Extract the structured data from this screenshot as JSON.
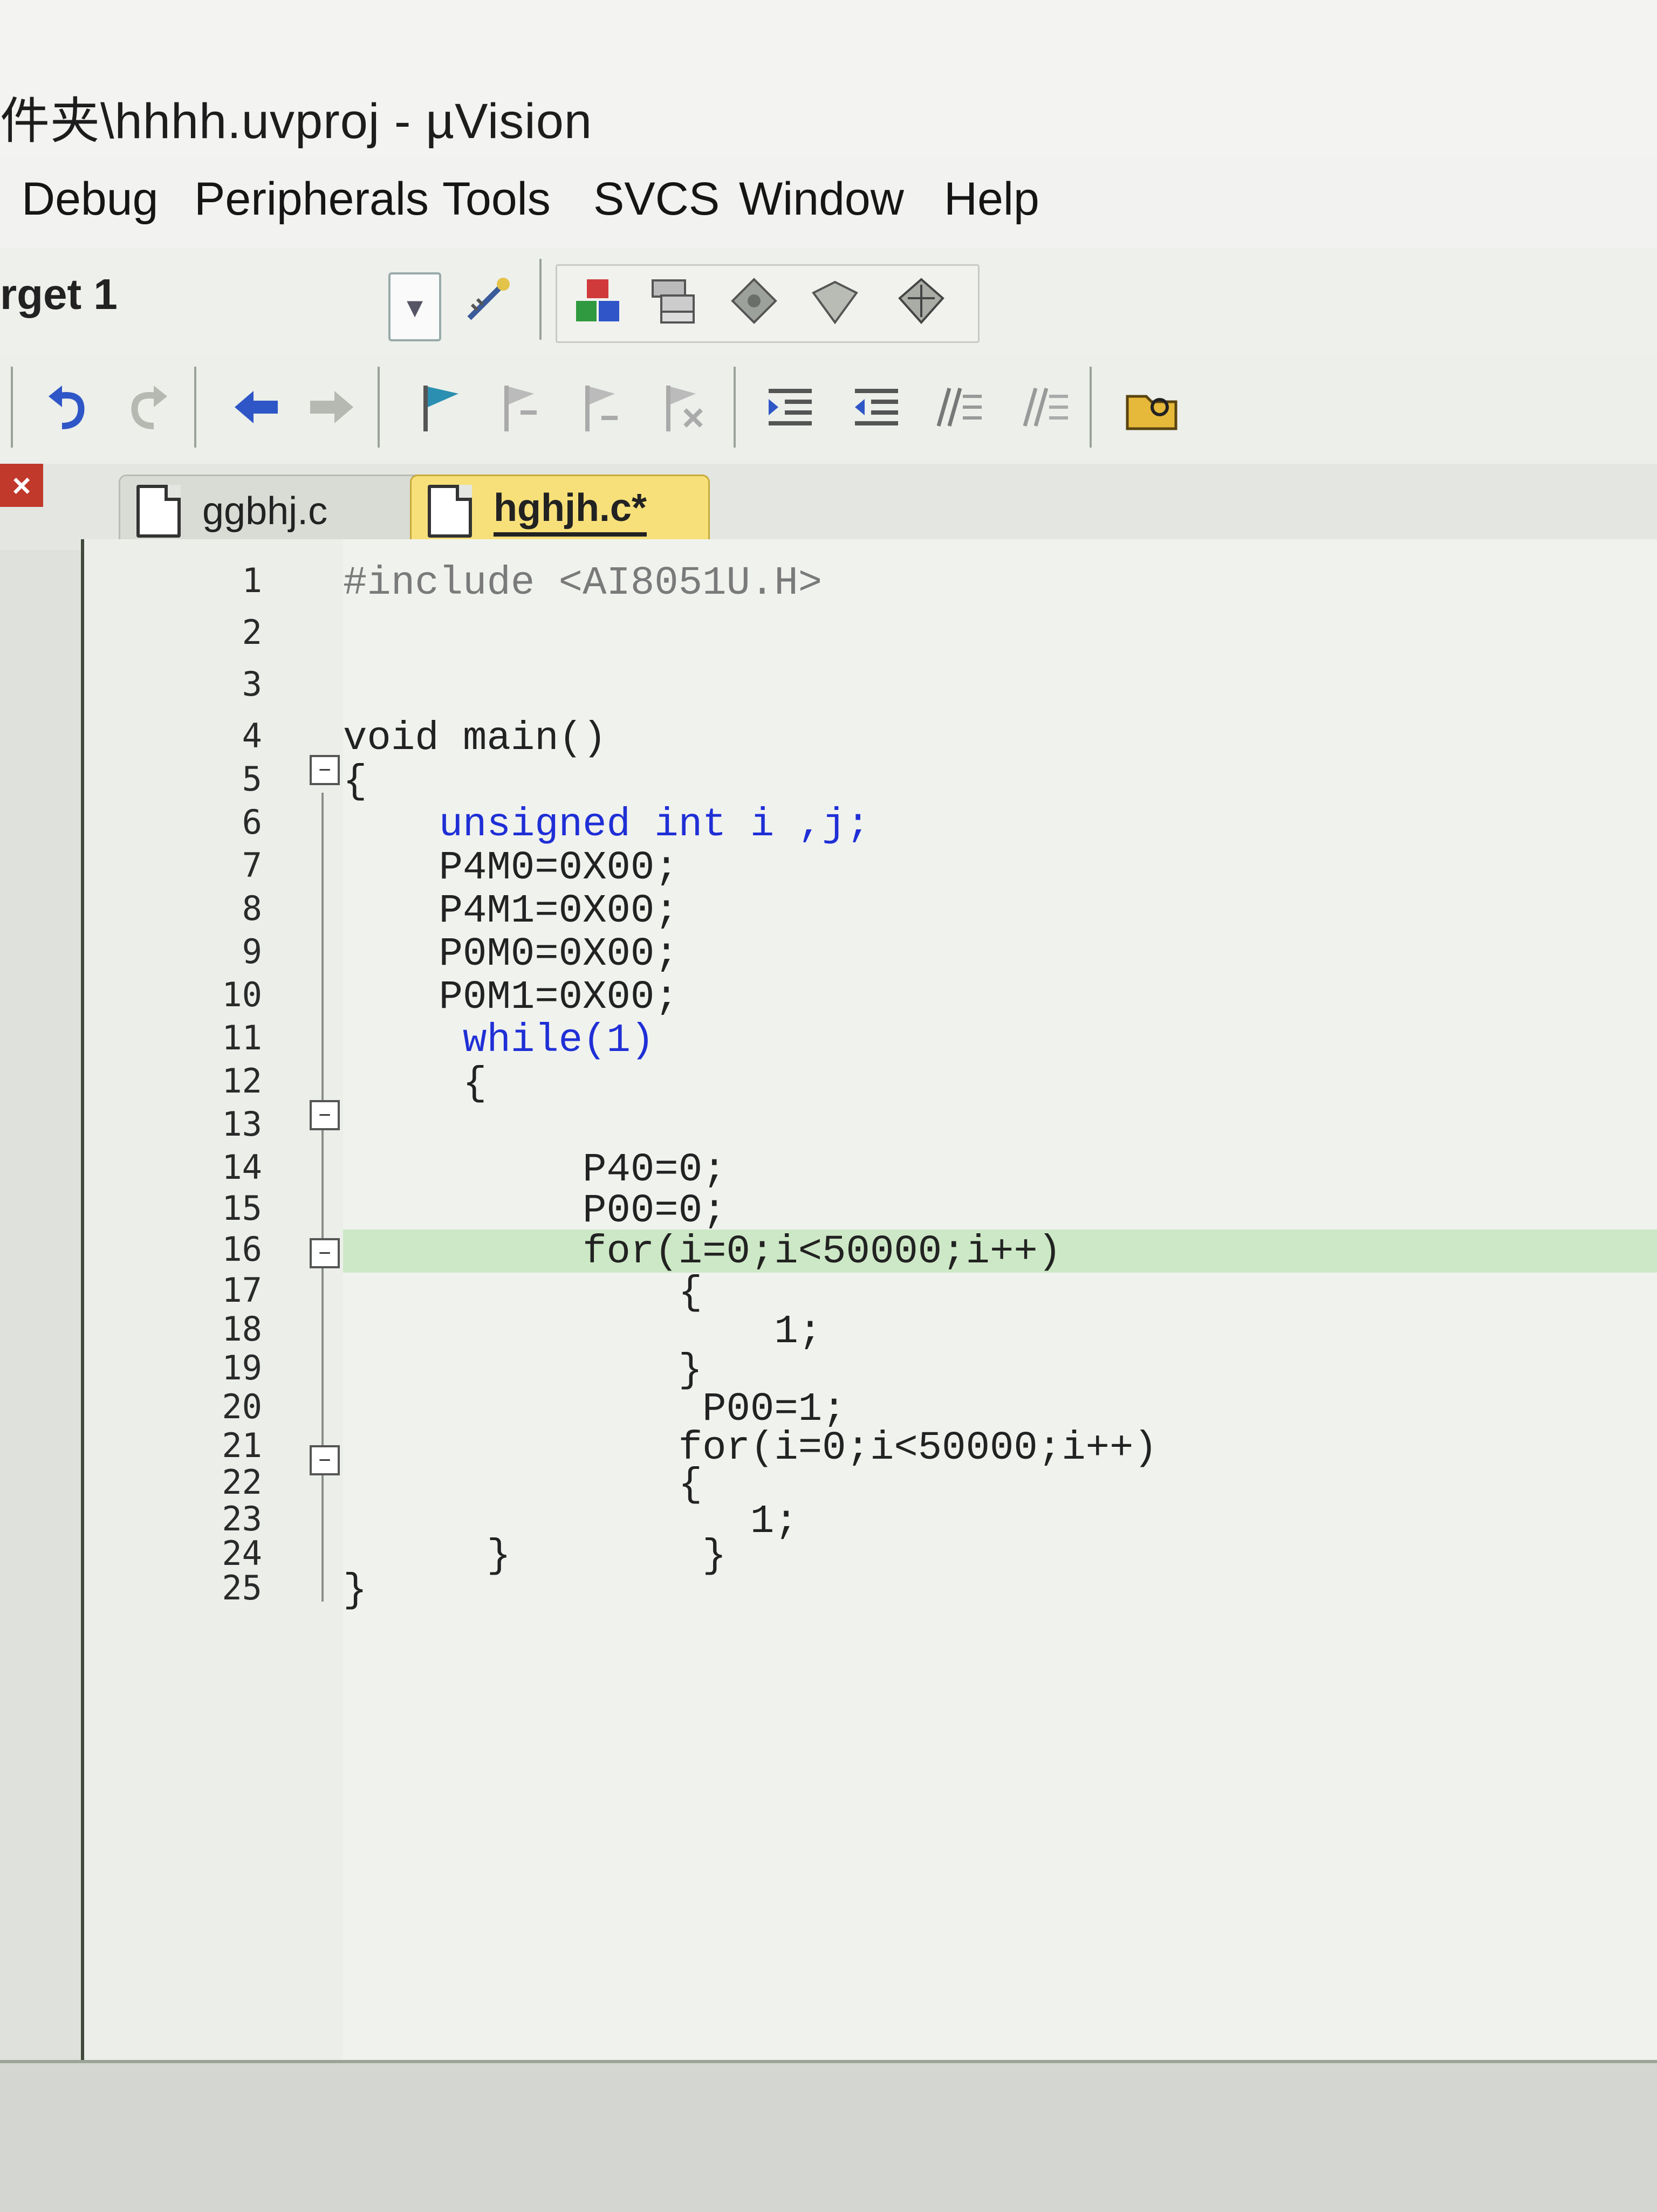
{
  "window": {
    "title": "件夹\\hhhh.uvproj - µVision"
  },
  "menu": [
    "Debug",
    "Peripherals",
    "Tools",
    "SVCS",
    "Window",
    "Help"
  ],
  "toolbar": {
    "target": "rget 1",
    "icons_row1": [
      "target-options-icon",
      "manage-components-icon",
      "select-packs-icon",
      "pack-installer-icon",
      "manage-runtime-icon",
      "install-packs-icon"
    ],
    "icons_row2": [
      "undo-icon",
      "redo-icon",
      "navigate-back-icon",
      "navigate-forward-icon",
      "bookmark-icon",
      "bookmark-prev-icon",
      "bookmark-next-icon",
      "bookmark-clear-icon",
      "indent-icon",
      "unindent-icon",
      "comment-icon",
      "uncomment-icon",
      "find-in-files-icon"
    ]
  },
  "tabs": [
    {
      "label": "ggbhj.c",
      "active": false
    },
    {
      "label": "hghjh.c*",
      "active": true
    }
  ],
  "editor": {
    "lines": [
      {
        "no": "1",
        "text": "#include <AI8051U.H>"
      },
      {
        "no": "2",
        "text": ""
      },
      {
        "no": "3",
        "text": ""
      },
      {
        "no": "4",
        "text": "void main()"
      },
      {
        "no": "5",
        "text": "{"
      },
      {
        "no": "6",
        "text": "    unsigned int i ,j;"
      },
      {
        "no": "7",
        "text": "    P4M0=0X00;"
      },
      {
        "no": "8",
        "text": "    P4M1=0X00;"
      },
      {
        "no": "9",
        "text": "    P0M0=0X00;"
      },
      {
        "no": "10",
        "text": "    P0M1=0X00;"
      },
      {
        "no": "11",
        "text": "     while(1)"
      },
      {
        "no": "12",
        "text": "     {"
      },
      {
        "no": "13",
        "text": ""
      },
      {
        "no": "14",
        "text": "          P40=0;"
      },
      {
        "no": "15",
        "text": "          P00=0;"
      },
      {
        "no": "16",
        "text": "          for(i=0;i<50000;i++)"
      },
      {
        "no": "17",
        "text": "              {"
      },
      {
        "no": "18",
        "text": "                  1;"
      },
      {
        "no": "19",
        "text": "              }"
      },
      {
        "no": "20",
        "text": "               P00=1;"
      },
      {
        "no": "21",
        "text": "              for(i=0;i<50000;i++)"
      },
      {
        "no": "22",
        "text": "              {"
      },
      {
        "no": "23",
        "text": "                 1;"
      },
      {
        "no": "24",
        "text": "      }        }"
      },
      {
        "no": "25",
        "text": "}"
      }
    ],
    "current_line": "16"
  }
}
